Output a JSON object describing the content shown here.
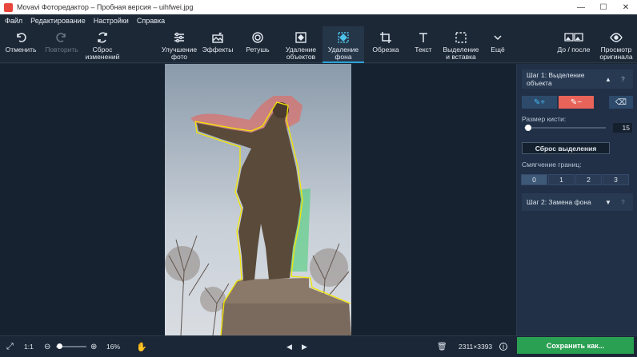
{
  "window": {
    "title": "Movavi Фоторедактор – Пробная версия – uihfwei.jpg",
    "minimize": "—",
    "maximize": "☐",
    "close": "✕"
  },
  "menu": [
    "Файл",
    "Редактирование",
    "Настройки",
    "Справка"
  ],
  "toolbar": {
    "undo": "Отменить",
    "redo": "Повторить",
    "reset": "Сброс изменений",
    "enhance": "Улучшение фото",
    "effects": "Эффекты",
    "retouch": "Ретушь",
    "object_removal": "Удаление объектов",
    "bg_removal": "Удаление фона",
    "crop": "Обрезка",
    "text": "Текст",
    "select_insert": "Выделение и вставка",
    "more": "Ещё",
    "before_after": "До / после",
    "view_original": "Просмотр оригинала"
  },
  "panel": {
    "step1_title": "Шаг 1: Выделение объекта",
    "step1_help": "?",
    "brush_size_label": "Размер кисти:",
    "brush_size_value": "15",
    "brush_size_fraction": 0.05,
    "reset_selection": "Сброс выделения",
    "edge_smoothing_label": "Смягчение границ:",
    "edge_options": [
      "0",
      "1",
      "2",
      "3"
    ],
    "edge_selected": "0",
    "step2_title": "Шаг 2: Замена фона",
    "step2_help": "?"
  },
  "bottom": {
    "fit_label": "1:1",
    "zoom_value": "16%",
    "zoom_fraction": 0.1,
    "dimensions": "2311×3393",
    "save_label": "Сохранить как..."
  },
  "colors": {
    "accent": "#2ea3d6",
    "save": "#2aa052",
    "erase_brush": "#e8645a",
    "keep_brush": "#1f8fd8"
  }
}
